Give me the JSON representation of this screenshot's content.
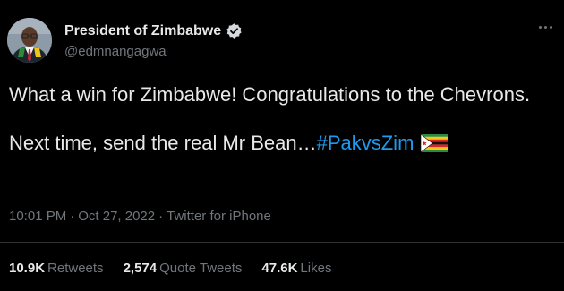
{
  "user": {
    "display_name": "President of Zimbabwe",
    "handle": "@edmnangagwa",
    "verified_icon": "verified-badge-icon"
  },
  "tweet": {
    "line1": "What a win for Zimbabwe! Congratulations to the Chevrons.",
    "line2_text": "Next time, send the real Mr Bean…",
    "hashtag": "#PakvsZim",
    "flag_icon": "zimbabwe-flag-icon"
  },
  "meta": {
    "time": "10:01 PM",
    "date": "Oct 27, 2022",
    "source": "Twitter for iPhone",
    "separator": "·"
  },
  "stats": {
    "retweets_count": "10.9K",
    "retweets_label": "Retweets",
    "quotes_count": "2,574",
    "quotes_label": "Quote Tweets",
    "likes_count": "47.6K",
    "likes_label": "Likes"
  },
  "colors": {
    "background": "#000000",
    "text": "#e7e9ea",
    "muted": "#71767b",
    "link": "#1d9bf0",
    "divider": "#2f3336"
  }
}
